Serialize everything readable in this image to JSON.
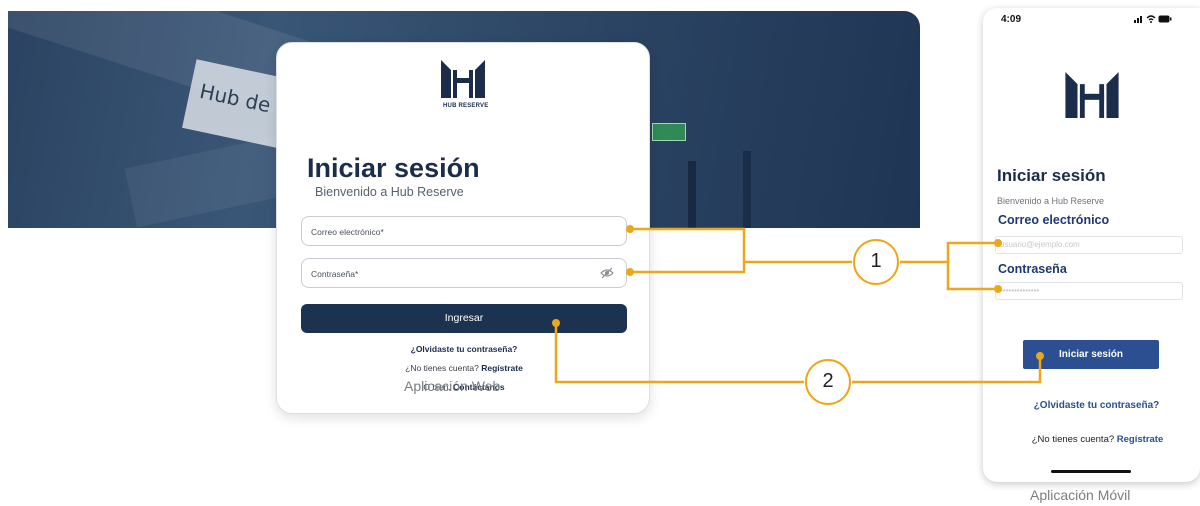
{
  "web": {
    "logo_text": "HUB RESERVE",
    "title": "Iniciar sesión",
    "subtitle": "Bienvenido a Hub Reserve",
    "email_label": "Correo electrónico",
    "password_label": "Contraseña",
    "required_mark": "*",
    "submit_label": "Ingresar",
    "forgot_label": "¿Olvidaste tu contraseña?",
    "no_account_text": "¿No tienes cuenta?",
    "register_label": "Regístrate",
    "contact_prefix": "O bien,",
    "contact_label": "Contáctanos",
    "hero_sign_text": "Hub de C"
  },
  "mobile": {
    "time": "4:09",
    "status_icons": "signal wifi battery",
    "title": "Iniciar sesión",
    "subtitle": "Bienvenido a Hub Reserve",
    "email_label": "Correo electrónico",
    "email_placeholder": "usuario@ejemplo.com",
    "password_label": "Contraseña",
    "password_placeholder": "••••••••••••••",
    "submit_label": "Iniciar sesión",
    "forgot_label": "¿Olvidaste tu contraseña?",
    "no_account_text": "¿No tienes cuenta?",
    "register_label": "Regístrate"
  },
  "captions": {
    "web": "Aplicación Web",
    "mobile": "Aplicación Móvil"
  },
  "annotations": {
    "badge_1": "1",
    "badge_2": "2"
  },
  "colors": {
    "navy": "#1c3251",
    "mobile_accent": "#2c4f91",
    "annotation": "#eda71a"
  }
}
